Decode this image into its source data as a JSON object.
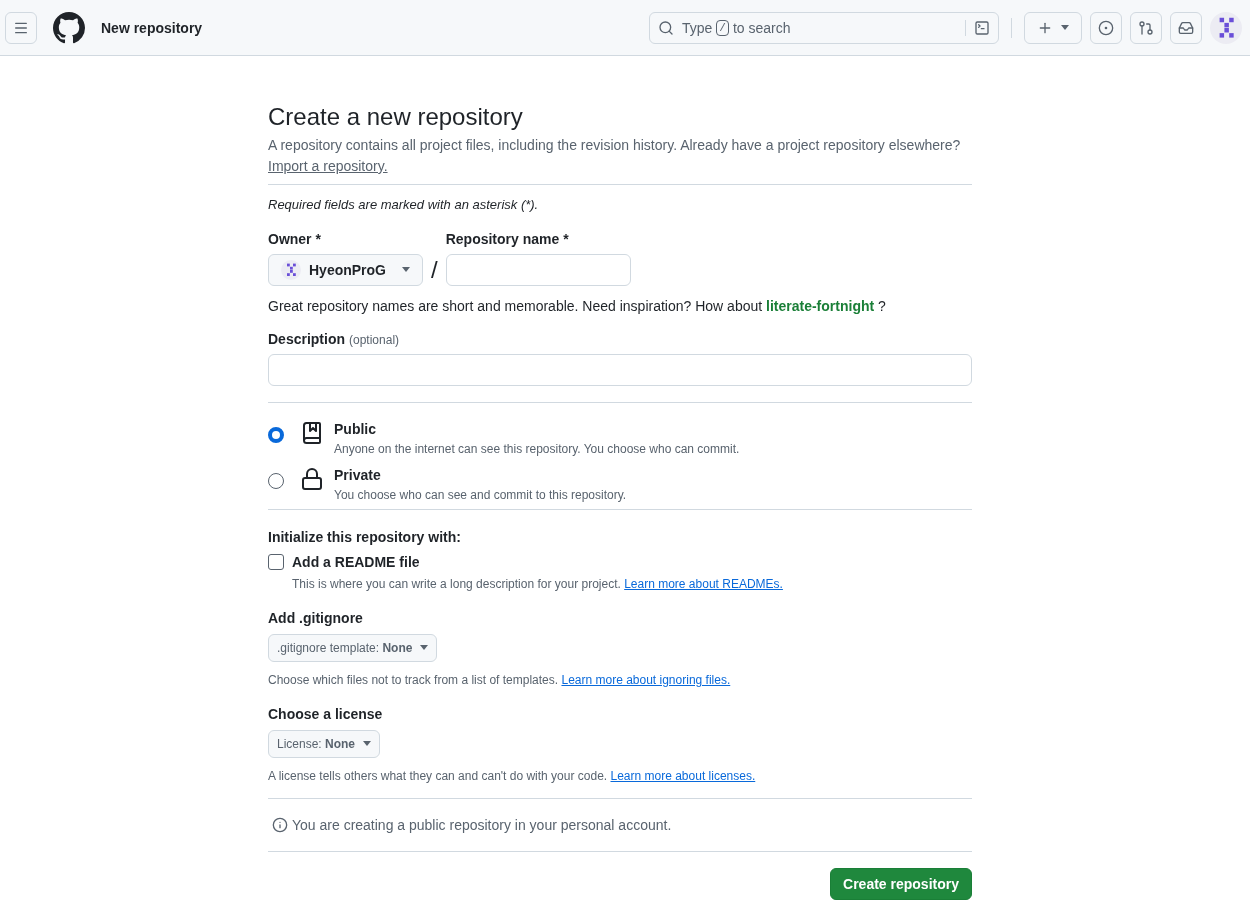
{
  "header": {
    "title": "New repository",
    "search": {
      "before": "Type",
      "key": "/",
      "after": "to search"
    }
  },
  "page": {
    "title": "Create a new repository",
    "intro": "A repository contains all project files, including the revision history. Already have a project repository elsewhere?",
    "import_link": "Import a repository.",
    "required_note": "Required fields are marked with an asterisk (*)."
  },
  "owner": {
    "label": "Owner *",
    "value": "HyeonProG"
  },
  "separator": "/",
  "repo_name": {
    "label": "Repository name *"
  },
  "suggestion": {
    "text": "Great repository names are short and memorable. Need inspiration? How about",
    "name": "literate-fortnight",
    "after": "?"
  },
  "description": {
    "label": "Description",
    "hint": "(optional)"
  },
  "visibility": [
    {
      "kind": "repo",
      "label": "Public",
      "detail": "Anyone on the internet can see this repository. You choose who can commit.",
      "selected": true
    },
    {
      "kind": "lock",
      "label": "Private",
      "detail": "You choose who can see and commit to this repository.",
      "selected": false
    }
  ],
  "initialize": {
    "heading": "Initialize this repository with:",
    "readme": {
      "label": "Add a README file",
      "checked": false,
      "detail": "This is where you can write a long description for your project.",
      "link": "Learn more about READMEs."
    }
  },
  "gitignore": {
    "heading": "Add .gitignore",
    "select": ".gitignore template: **None**",
    "detail": "Choose which files not to track from a list of templates.",
    "link": "Learn more about ignoring files."
  },
  "license": {
    "heading": "Choose a license",
    "select": "License: **None**",
    "detail": "A license tells others what they can and can't do with your code.",
    "link": "Learn more about licenses."
  },
  "notice": "You are creating a public repository in your personal account.",
  "submit": "Create repository"
}
